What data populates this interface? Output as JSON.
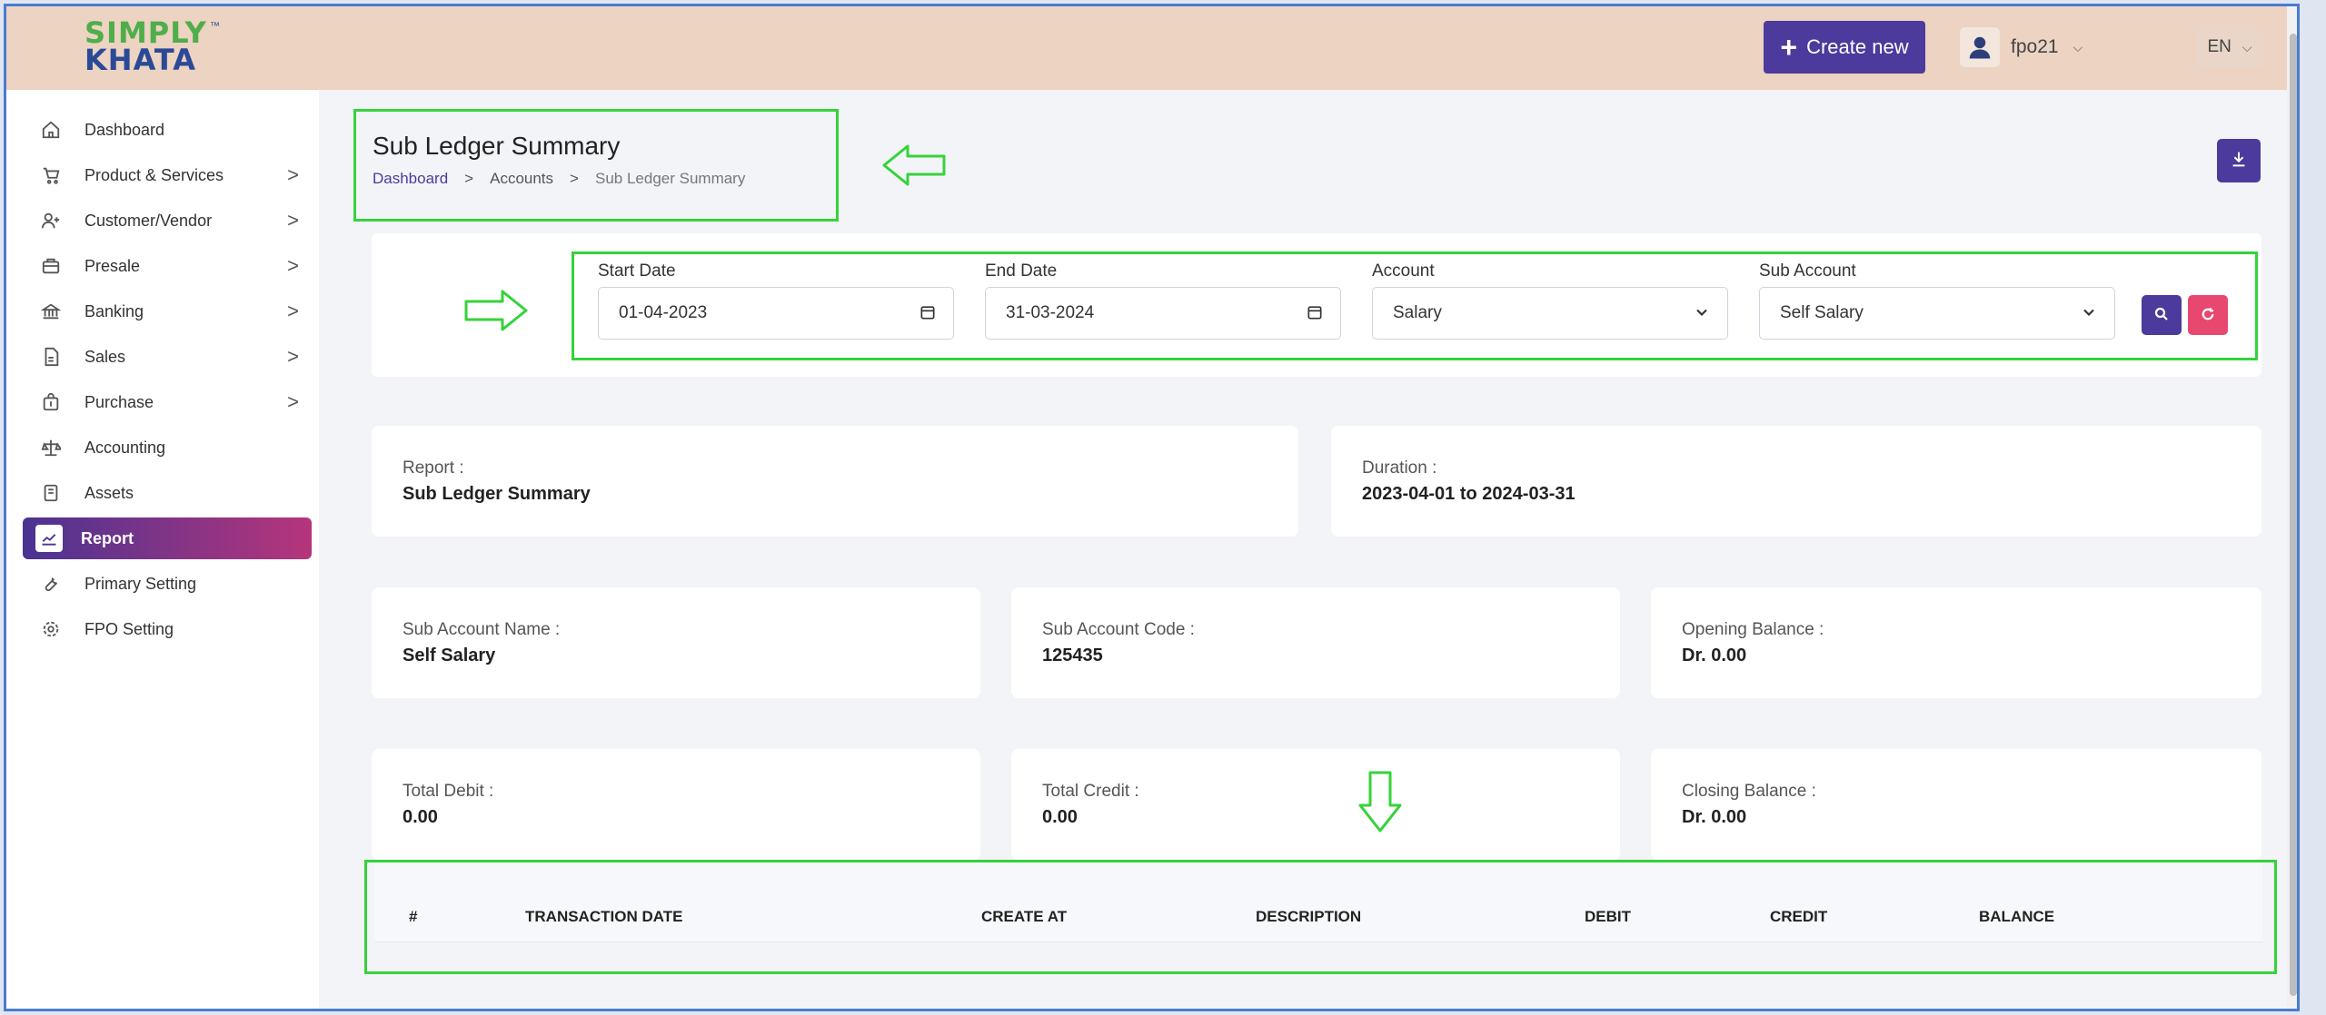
{
  "header": {
    "logo_line1": "SIMPLY",
    "logo_line2": "KHATA",
    "logo_tm": "™",
    "create_button": "Create new",
    "username": "fpo21",
    "language": "EN"
  },
  "sidebar": {
    "items": [
      {
        "label": "Dashboard",
        "icon": "home-icon"
      },
      {
        "label": "Product & Services",
        "icon": "cart-icon",
        "arrow": ">"
      },
      {
        "label": "Customer/Vendor",
        "icon": "user-plus-icon",
        "arrow": ">"
      },
      {
        "label": "Presale",
        "icon": "box-icon",
        "arrow": ">"
      },
      {
        "label": "Banking",
        "icon": "bank-icon",
        "arrow": ">"
      },
      {
        "label": "Sales",
        "icon": "file-icon",
        "arrow": ">"
      },
      {
        "label": "Purchase",
        "icon": "bag-icon",
        "arrow": ">"
      },
      {
        "label": "Accounting",
        "icon": "scale-icon"
      },
      {
        "label": "Assets",
        "icon": "asset-icon"
      },
      {
        "label": "Report",
        "icon": "chart-icon",
        "active": true
      },
      {
        "label": "Primary Setting",
        "icon": "tool-icon"
      },
      {
        "label": "FPO Setting",
        "icon": "gear-icon"
      }
    ]
  },
  "page": {
    "title": "Sub Ledger Summary",
    "breadcrumb": [
      "Dashboard",
      ">",
      "Accounts",
      ">",
      "Sub Ledger Summary"
    ]
  },
  "filters": {
    "start_date_label": "Start Date",
    "start_date_value": "01-04-2023",
    "end_date_label": "End Date",
    "end_date_value": "31-03-2024",
    "account_label": "Account",
    "account_value": "Salary",
    "sub_account_label": "Sub Account",
    "sub_account_value": "Self Salary"
  },
  "summary": {
    "report_label": "Report :",
    "report_value": "Sub Ledger Summary",
    "duration_label": "Duration :",
    "duration_value": "2023-04-01 to 2024-03-31",
    "sub_account_name_label": "Sub Account Name :",
    "sub_account_name_value": "Self Salary",
    "sub_account_code_label": "Sub Account Code :",
    "sub_account_code_value": "125435",
    "opening_balance_label": "Opening Balance :",
    "opening_balance_value": "Dr. 0.00",
    "total_debit_label": "Total Debit :",
    "total_debit_value": "0.00",
    "total_credit_label": "Total Credit :",
    "total_credit_value": "0.00",
    "closing_balance_label": "Closing Balance :",
    "closing_balance_value": "Dr. 0.00"
  },
  "table": {
    "columns": [
      "#",
      "TRANSACTION DATE",
      "CREATE AT",
      "DESCRIPTION",
      "DEBIT",
      "CREDIT",
      "BALANCE"
    ]
  },
  "colors": {
    "header_bg": "#ecd3c2",
    "primary": "#4c3a9c",
    "danger": "#e84770",
    "annotation": "#35d33a"
  }
}
